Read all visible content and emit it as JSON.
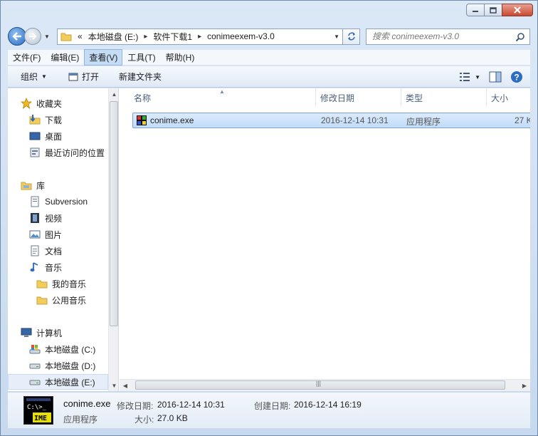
{
  "window": {
    "title": "",
    "caption_buttons": [
      "minimize-icon",
      "maximize-icon",
      "close-icon"
    ]
  },
  "address": {
    "overflow": "«",
    "crumbs": [
      "本地磁盘 (E:)",
      "软件下载1",
      "conimeexem-v3.0"
    ],
    "search_placeholder": "搜索 conimeexem-v3.0"
  },
  "menu": {
    "items": [
      "文件(F)",
      "编辑(E)",
      "查看(V)",
      "工具(T)",
      "帮助(H)"
    ],
    "active_index": 2
  },
  "toolbar": {
    "organize": "组织",
    "open": "打开",
    "new_folder": "新建文件夹"
  },
  "nav": {
    "favorites": {
      "label": "收藏夹",
      "items": [
        "下载",
        "桌面",
        "最近访问的位置"
      ]
    },
    "libraries": {
      "label": "库",
      "items": [
        "Subversion",
        "视频",
        "图片",
        "文档",
        "音乐"
      ],
      "music_children": [
        "我的音乐",
        "公用音乐"
      ]
    },
    "computer": {
      "label": "计算机",
      "drives": [
        "本地磁盘 (C:)",
        "本地磁盘 (D:)",
        "本地磁盘 (E:)"
      ],
      "selected_index": 2
    }
  },
  "columns": [
    "名称",
    "修改日期",
    "类型",
    "大小"
  ],
  "files": [
    {
      "name": "conime.exe",
      "modified": "2016-12-14 10:31",
      "type": "应用程序",
      "size": "27 K"
    }
  ],
  "details": {
    "file_name": "conime.exe",
    "file_type": "应用程序",
    "modified_label": "修改日期:",
    "modified_value": "2016-12-14 10:31",
    "created_label": "创建日期:",
    "created_value": "2016-12-14 16:19",
    "size_label": "大小:",
    "size_value": "27.0 KB",
    "thumb_text_top": "C:\\>_",
    "thumb_text_bottom": "IME"
  },
  "colors": {
    "selection": "#cce4fc",
    "accent": "#2a6cc2",
    "close_button": "#c94a33"
  }
}
